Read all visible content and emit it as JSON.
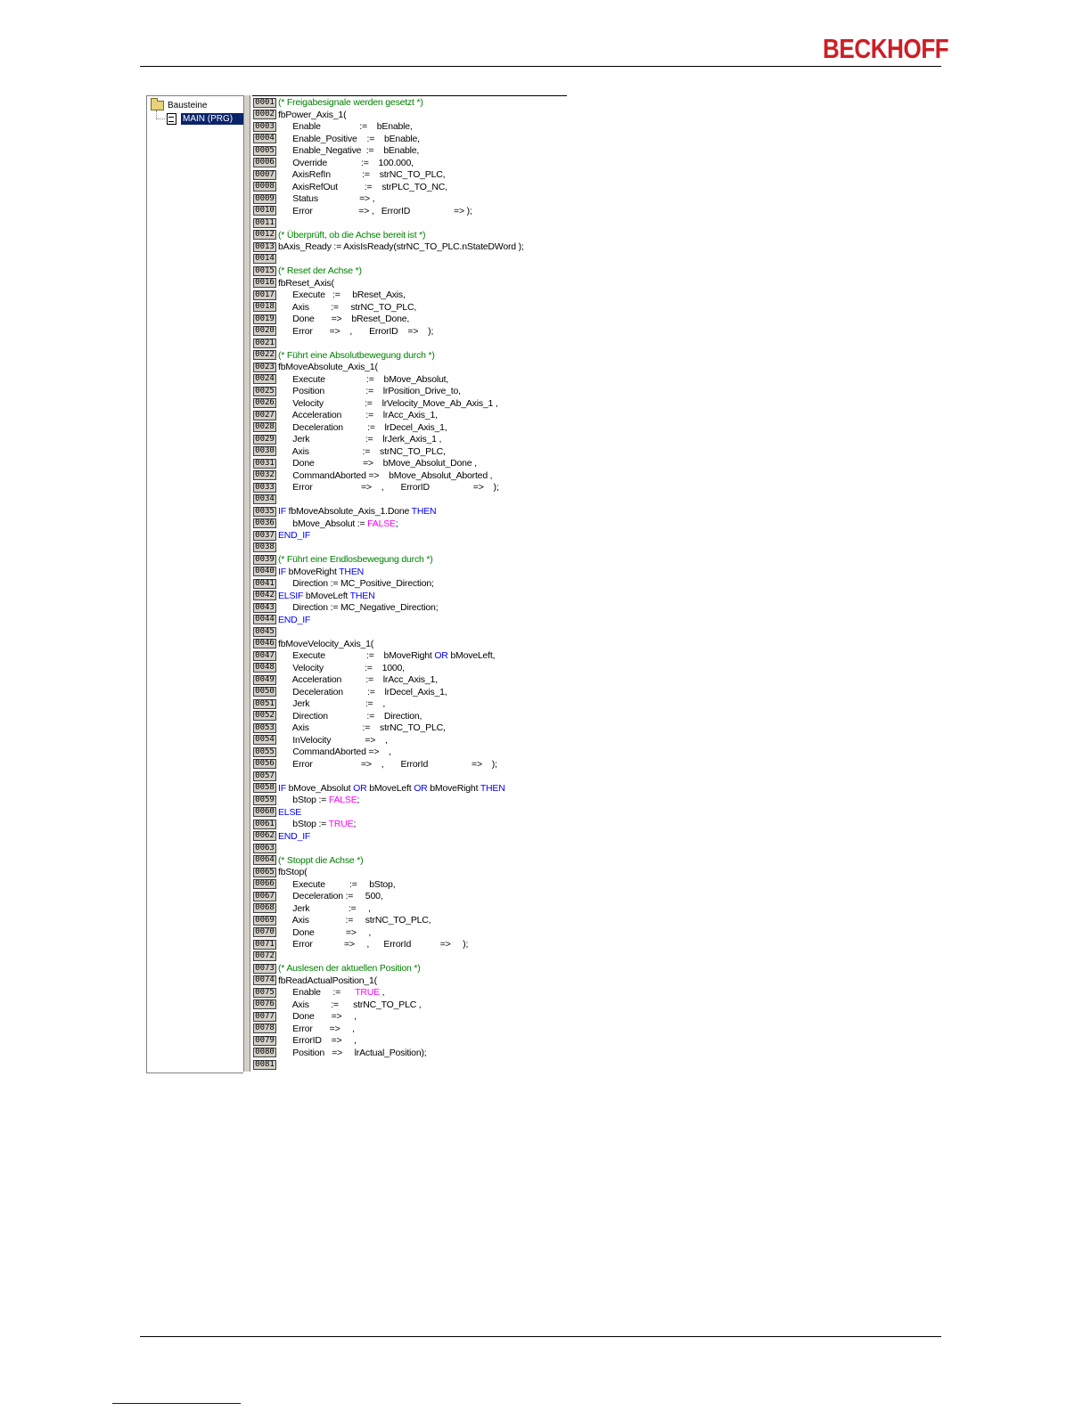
{
  "header": {
    "logo_text": "BECKHOFF"
  },
  "tree": {
    "root_label": "Bausteine",
    "selected_item": "MAIN (PRG)"
  },
  "editor": {
    "lines": [
      {
        "n": "0001",
        "segs": [
          {
            "t": "(* Freigabesignale werden gesetzt *)",
            "c": "comment"
          }
        ]
      },
      {
        "n": "0002",
        "segs": [
          {
            "t": "fbPower_Axis_1("
          }
        ]
      },
      {
        "n": "0003",
        "segs": [
          {
            "t": "      Enable                :=    bEnable,"
          }
        ]
      },
      {
        "n": "0004",
        "segs": [
          {
            "t": "      Enable_Positive    :=    bEnable,"
          }
        ]
      },
      {
        "n": "0005",
        "segs": [
          {
            "t": "      Enable_Negative  :=    bEnable,"
          }
        ]
      },
      {
        "n": "0006",
        "segs": [
          {
            "t": "      Override              :=    100.000,"
          }
        ]
      },
      {
        "n": "0007",
        "segs": [
          {
            "t": "      AxisRefIn             :=    strNC_TO_PLC,"
          }
        ]
      },
      {
        "n": "0008",
        "segs": [
          {
            "t": "      AxisRefOut           :=    strPLC_TO_NC,"
          }
        ]
      },
      {
        "n": "0009",
        "segs": [
          {
            "t": "      Status                 => ,"
          }
        ]
      },
      {
        "n": "0010",
        "segs": [
          {
            "t": "      Error                   => ,   ErrorID                  => );"
          }
        ]
      },
      {
        "n": "0011",
        "segs": []
      },
      {
        "n": "0012",
        "segs": [
          {
            "t": "(* Überprüft, ob die Achse bereit ist *)",
            "c": "comment"
          }
        ]
      },
      {
        "n": "0013",
        "segs": [
          {
            "t": "bAxis_Ready := AxisIsReady(strNC_TO_PLC.nStateDWord );"
          }
        ]
      },
      {
        "n": "0014",
        "segs": []
      },
      {
        "n": "0015",
        "segs": [
          {
            "t": "(* Reset der Achse *)",
            "c": "comment"
          }
        ]
      },
      {
        "n": "0016",
        "segs": [
          {
            "t": "fbReset_Axis("
          }
        ]
      },
      {
        "n": "0017",
        "segs": [
          {
            "t": "      Execute   :=     bReset_Axis,"
          }
        ]
      },
      {
        "n": "0018",
        "segs": [
          {
            "t": "      Axis         :=     strNC_TO_PLC,"
          }
        ]
      },
      {
        "n": "0019",
        "segs": [
          {
            "t": "      Done       =>    bReset_Done,"
          }
        ]
      },
      {
        "n": "0020",
        "segs": [
          {
            "t": "      Error       =>    ,       ErrorID    =>    );"
          }
        ]
      },
      {
        "n": "0021",
        "segs": []
      },
      {
        "n": "0022",
        "segs": [
          {
            "t": "(* Führt eine Absolutbewegung durch *)",
            "c": "comment"
          }
        ]
      },
      {
        "n": "0023",
        "segs": [
          {
            "t": "fbMoveAbsolute_Axis_1("
          }
        ]
      },
      {
        "n": "0024",
        "segs": [
          {
            "t": "      Execute                 :=    bMove_Absolut,"
          }
        ]
      },
      {
        "n": "0025",
        "segs": [
          {
            "t": "      Position                 :=    lrPosition_Drive_to,"
          }
        ]
      },
      {
        "n": "0026",
        "segs": [
          {
            "t": "      Velocity                 :=    lrVelocity_Move_Ab_Axis_1 ,"
          }
        ]
      },
      {
        "n": "0027",
        "segs": [
          {
            "t": "      Acceleration          :=    lrAcc_Axis_1,"
          }
        ]
      },
      {
        "n": "0028",
        "segs": [
          {
            "t": "      Deceleration          :=    lrDecel_Axis_1,"
          }
        ]
      },
      {
        "n": "0029",
        "segs": [
          {
            "t": "      Jerk                       :=    lrJerk_Axis_1 ,"
          }
        ]
      },
      {
        "n": "0030",
        "segs": [
          {
            "t": "      Axis                      :=    strNC_TO_PLC,"
          }
        ]
      },
      {
        "n": "0031",
        "segs": [
          {
            "t": "      Done                    =>    bMove_Absolut_Done ,"
          }
        ]
      },
      {
        "n": "0032",
        "segs": [
          {
            "t": "      CommandAborted =>    bMove_Absolut_Aborted ,"
          }
        ]
      },
      {
        "n": "0033",
        "segs": [
          {
            "t": "      Error                    =>    ,       ErrorID                  =>    );"
          }
        ]
      },
      {
        "n": "0034",
        "segs": []
      },
      {
        "n": "0035",
        "segs": [
          {
            "t": "IF",
            "c": "kw"
          },
          {
            "t": " fbMoveAbsolute_Axis_1.Done "
          },
          {
            "t": "THEN",
            "c": "kw"
          }
        ]
      },
      {
        "n": "0036",
        "segs": [
          {
            "t": "      bMove_Absolut := "
          },
          {
            "t": "FALSE",
            "c": "lit"
          },
          {
            "t": ";"
          }
        ]
      },
      {
        "n": "0037",
        "segs": [
          {
            "t": "END_IF",
            "c": "kw"
          }
        ]
      },
      {
        "n": "0038",
        "segs": []
      },
      {
        "n": "0039",
        "segs": [
          {
            "t": "(* Führt eine Endlosbewegung durch *)",
            "c": "comment"
          }
        ]
      },
      {
        "n": "0040",
        "segs": [
          {
            "t": "IF",
            "c": "kw"
          },
          {
            "t": " bMoveRight "
          },
          {
            "t": "THEN",
            "c": "kw"
          }
        ]
      },
      {
        "n": "0041",
        "segs": [
          {
            "t": "      Direction := MC_Positive_Direction;"
          }
        ]
      },
      {
        "n": "0042",
        "segs": [
          {
            "t": "ELSIF",
            "c": "kw"
          },
          {
            "t": " bMoveLeft "
          },
          {
            "t": "THEN",
            "c": "kw"
          }
        ]
      },
      {
        "n": "0043",
        "segs": [
          {
            "t": "      Direction := MC_Negative_Direction;"
          }
        ]
      },
      {
        "n": "0044",
        "segs": [
          {
            "t": "END_IF",
            "c": "kw"
          }
        ]
      },
      {
        "n": "0045",
        "segs": []
      },
      {
        "n": "0046",
        "segs": [
          {
            "t": "fbMoveVelocity_Axis_1("
          }
        ]
      },
      {
        "n": "0047",
        "segs": [
          {
            "t": "      Execute                 :=    bMoveRight "
          },
          {
            "t": "OR",
            "c": "kw"
          },
          {
            "t": " bMoveLeft,"
          }
        ]
      },
      {
        "n": "0048",
        "segs": [
          {
            "t": "      Velocity                 :=    1000,"
          }
        ]
      },
      {
        "n": "0049",
        "segs": [
          {
            "t": "      Acceleration          :=    lrAcc_Axis_1,"
          }
        ]
      },
      {
        "n": "0050",
        "segs": [
          {
            "t": "      Deceleration          :=    lrDecel_Axis_1,"
          }
        ]
      },
      {
        "n": "0051",
        "segs": [
          {
            "t": "      Jerk                       :=    ,"
          }
        ]
      },
      {
        "n": "0052",
        "segs": [
          {
            "t": "      Direction                :=    Direction,"
          }
        ]
      },
      {
        "n": "0053",
        "segs": [
          {
            "t": "      Axis                      :=    strNC_TO_PLC,"
          }
        ]
      },
      {
        "n": "0054",
        "segs": [
          {
            "t": "      InVelocity              =>    ,"
          }
        ]
      },
      {
        "n": "0055",
        "segs": [
          {
            "t": "      CommandAborted =>    ,"
          }
        ]
      },
      {
        "n": "0056",
        "segs": [
          {
            "t": "      Error                    =>    ,       ErrorId                  =>    );"
          }
        ]
      },
      {
        "n": "0057",
        "segs": []
      },
      {
        "n": "0058",
        "segs": [
          {
            "t": "IF",
            "c": "kw"
          },
          {
            "t": " bMove_Absolut "
          },
          {
            "t": "OR",
            "c": "kw"
          },
          {
            "t": " bMoveLeft "
          },
          {
            "t": "OR",
            "c": "kw"
          },
          {
            "t": " bMoveRight "
          },
          {
            "t": "THEN",
            "c": "kw"
          }
        ]
      },
      {
        "n": "0059",
        "segs": [
          {
            "t": "      bStop := "
          },
          {
            "t": "FALSE",
            "c": "lit"
          },
          {
            "t": ";"
          }
        ]
      },
      {
        "n": "0060",
        "segs": [
          {
            "t": "ELSE",
            "c": "kw"
          }
        ]
      },
      {
        "n": "0061",
        "segs": [
          {
            "t": "      bStop := "
          },
          {
            "t": "TRUE",
            "c": "lit"
          },
          {
            "t": ";"
          }
        ]
      },
      {
        "n": "0062",
        "segs": [
          {
            "t": "END_IF",
            "c": "kw"
          }
        ]
      },
      {
        "n": "0063",
        "segs": []
      },
      {
        "n": "0064",
        "segs": [
          {
            "t": "(* Stoppt die Achse *)",
            "c": "comment"
          }
        ]
      },
      {
        "n": "0065",
        "segs": [
          {
            "t": "fbStop("
          }
        ]
      },
      {
        "n": "0066",
        "segs": [
          {
            "t": "      Execute          :=     bStop,"
          }
        ]
      },
      {
        "n": "0067",
        "segs": [
          {
            "t": "      Deceleration :=     500,"
          }
        ]
      },
      {
        "n": "0068",
        "segs": [
          {
            "t": "      Jerk                :=     ,"
          }
        ]
      },
      {
        "n": "0069",
        "segs": [
          {
            "t": "      Axis               :=     strNC_TO_PLC,"
          }
        ]
      },
      {
        "n": "0070",
        "segs": [
          {
            "t": "      Done             =>     ,"
          }
        ]
      },
      {
        "n": "0071",
        "segs": [
          {
            "t": "      Error             =>     ,      ErrorId            =>     );"
          }
        ]
      },
      {
        "n": "0072",
        "segs": []
      },
      {
        "n": "0073",
        "segs": [
          {
            "t": "(* Auslesen der aktuellen Position *)",
            "c": "comment"
          }
        ]
      },
      {
        "n": "0074",
        "segs": [
          {
            "t": "fbReadActualPosition_1("
          }
        ]
      },
      {
        "n": "0075",
        "segs": [
          {
            "t": "      Enable     :=      "
          },
          {
            "t": "TRUE",
            "c": "lit"
          },
          {
            "t": " ,"
          }
        ]
      },
      {
        "n": "0076",
        "segs": [
          {
            "t": "      Axis         :=      strNC_TO_PLC ,"
          }
        ]
      },
      {
        "n": "0077",
        "segs": [
          {
            "t": "      Done       =>     ,"
          }
        ]
      },
      {
        "n": "0078",
        "segs": [
          {
            "t": "      Error       =>     ,"
          }
        ]
      },
      {
        "n": "0079",
        "segs": [
          {
            "t": "      ErrorID    =>     ,"
          }
        ]
      },
      {
        "n": "0080",
        "segs": [
          {
            "t": "      Position   =>     lrActual_Position);"
          }
        ]
      },
      {
        "n": "0081",
        "segs": []
      }
    ]
  }
}
